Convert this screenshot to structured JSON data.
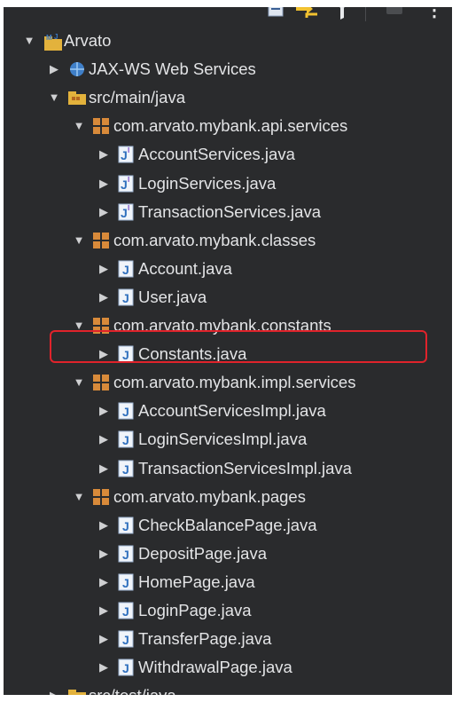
{
  "toolbar": {
    "menu_glyph": "⋮"
  },
  "tree": {
    "items": [
      {
        "label": "Arvato",
        "icon": "maven-project-icon",
        "depth": 0,
        "expanded": true
      },
      {
        "label": "JAX-WS Web Services",
        "icon": "web-services-icon",
        "depth": 1,
        "expanded": false
      },
      {
        "label": "src/main/java",
        "icon": "source-folder-icon",
        "depth": 1,
        "expanded": true
      },
      {
        "label": "com.arvato.mybank.api.services",
        "icon": "package-icon",
        "depth": 2,
        "expanded": true
      },
      {
        "label": "AccountServices.java",
        "icon": "interface-file-icon",
        "depth": 3,
        "expanded": false
      },
      {
        "label": "LoginServices.java",
        "icon": "interface-file-icon",
        "depth": 3,
        "expanded": false
      },
      {
        "label": "TransactionServices.java",
        "icon": "interface-file-icon",
        "depth": 3,
        "expanded": false
      },
      {
        "label": "com.arvato.mybank.classes",
        "icon": "package-icon",
        "depth": 2,
        "expanded": true
      },
      {
        "label": "Account.java",
        "icon": "java-file-icon",
        "depth": 3,
        "expanded": false
      },
      {
        "label": "User.java",
        "icon": "java-file-icon",
        "depth": 3,
        "expanded": false
      },
      {
        "label": "com.arvato.mybank.constants",
        "icon": "package-icon",
        "depth": 2,
        "expanded": true
      },
      {
        "label": "Constants.java",
        "icon": "java-file-icon",
        "depth": 3,
        "expanded": false,
        "selected": true
      },
      {
        "label": "com.arvato.mybank.impl.services",
        "icon": "package-icon",
        "depth": 2,
        "expanded": true
      },
      {
        "label": "AccountServicesImpl.java",
        "icon": "java-file-icon",
        "depth": 3,
        "expanded": false
      },
      {
        "label": "LoginServicesImpl.java",
        "icon": "java-file-icon",
        "depth": 3,
        "expanded": false
      },
      {
        "label": "TransactionServicesImpl.java",
        "icon": "java-file-icon",
        "depth": 3,
        "expanded": false
      },
      {
        "label": "com.arvato.mybank.pages",
        "icon": "package-icon",
        "depth": 2,
        "expanded": true
      },
      {
        "label": "CheckBalancePage.java",
        "icon": "java-file-icon",
        "depth": 3,
        "expanded": false
      },
      {
        "label": "DepositPage.java",
        "icon": "java-file-icon",
        "depth": 3,
        "expanded": false
      },
      {
        "label": "HomePage.java",
        "icon": "java-file-icon",
        "depth": 3,
        "expanded": false
      },
      {
        "label": "LoginPage.java",
        "icon": "java-file-icon",
        "depth": 3,
        "expanded": false
      },
      {
        "label": "TransferPage.java",
        "icon": "java-file-icon",
        "depth": 3,
        "expanded": false
      },
      {
        "label": "WithdrawalPage.java",
        "icon": "java-file-icon",
        "depth": 3,
        "expanded": false
      },
      {
        "label": "src/test/java",
        "icon": "test-source-folder-icon",
        "depth": 1,
        "expanded": false
      }
    ]
  },
  "colors": {
    "background": "#2a2b2d",
    "text": "#e3e4e6",
    "selection_outline": "#e0232b",
    "java_icon": "#2f7fd0",
    "package_icon": "#c9772a"
  }
}
